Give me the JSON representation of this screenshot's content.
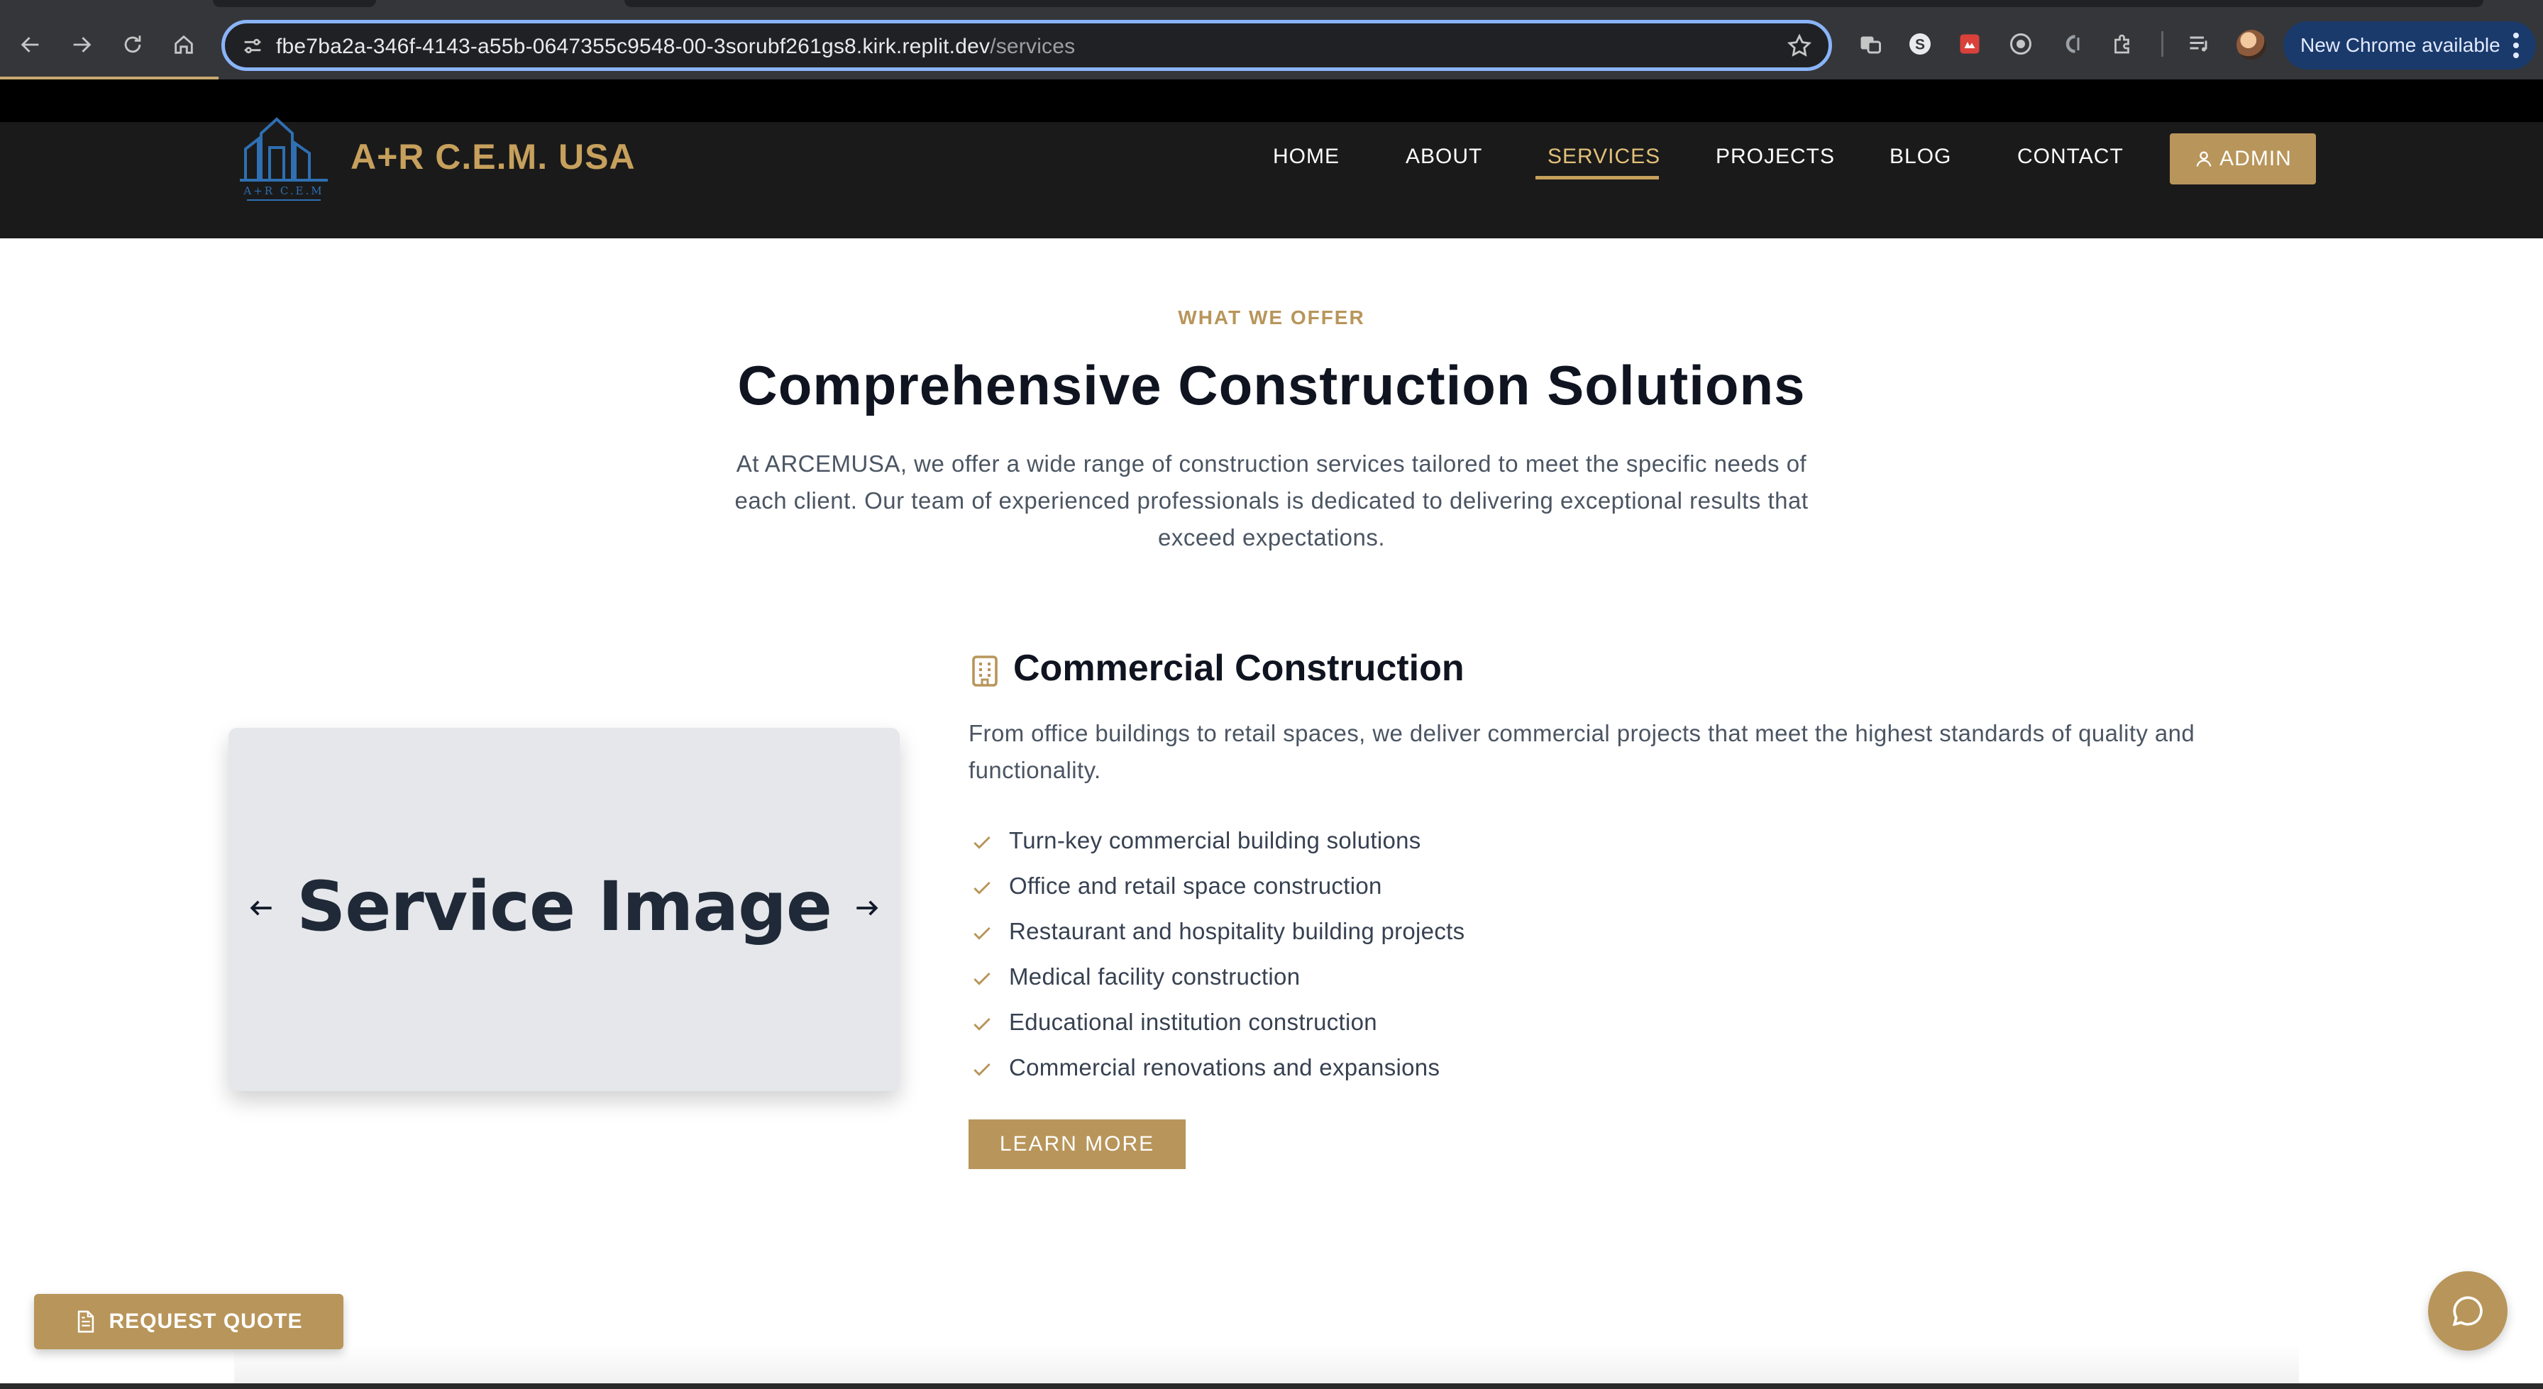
{
  "browser": {
    "url_host": "fbe7ba2a-346f-4143-a55b-0647355c9548-00-3sorubf261gs8.kirk.replit.dev",
    "url_path": "/services",
    "update_label": "New Chrome available",
    "loading_progress": 0.086
  },
  "site": {
    "brand": "A+R C.E.M. USA",
    "logo_caption": "A+R C.E.M",
    "nav": [
      "HOME",
      "ABOUT",
      "SERVICES",
      "PROJECTS",
      "BLOG",
      "CONTACT"
    ],
    "active_nav": "SERVICES",
    "admin_label": "ADMIN"
  },
  "intro": {
    "eyebrow": "WHAT WE OFFER",
    "headline": "Comprehensive Construction Solutions",
    "body": "At ARCEMUSA, we offer a wide range of construction services tailored to meet the specific needs of each client. Our team of experienced professionals is dedicated to delivering exceptional results that exceed expectations."
  },
  "service": {
    "image_placeholder": "Service Image",
    "title": "Commercial Construction",
    "description": "From office buildings to retail spaces, we deliver commercial projects that meet the highest standards of quality and functionality.",
    "features": [
      "Turn-key commercial building solutions",
      "Office and retail space construction",
      "Restaurant and hospitality building projects",
      "Medical facility construction",
      "Educational institution construction",
      "Commercial renovations and expansions"
    ],
    "cta": "LEARN MORE"
  },
  "widgets": {
    "quote_label": "REQUEST QUOTE"
  },
  "colors": {
    "accent_gold": "#b8955a",
    "header_dark": "#1a1a1a",
    "heading": "#0f1420",
    "body_text": "#4b5563",
    "chrome_focus": "#8ab4f8"
  }
}
